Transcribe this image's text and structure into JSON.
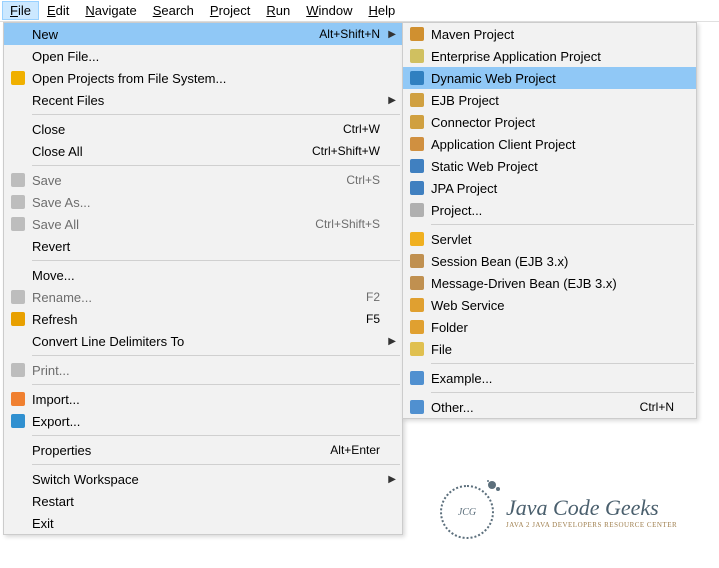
{
  "menubar": [
    {
      "label": "File",
      "mn": "F",
      "active": true
    },
    {
      "label": "Edit",
      "mn": "E"
    },
    {
      "label": "Navigate",
      "mn": "N"
    },
    {
      "label": "Search",
      "mn": "S"
    },
    {
      "label": "Project",
      "mn": "P"
    },
    {
      "label": "Run",
      "mn": "R"
    },
    {
      "label": "Window",
      "mn": "W"
    },
    {
      "label": "Help",
      "mn": "H"
    }
  ],
  "file_menu": [
    {
      "label": "New",
      "accel": "Alt+Shift+N",
      "submenu": true,
      "highlighted": true
    },
    {
      "label": "Open File..."
    },
    {
      "label": "Open Projects from File System...",
      "icon": "folder-open-icon",
      "iconColor": "#f0b000"
    },
    {
      "label": "Recent Files",
      "submenu": true
    },
    {
      "sep": true
    },
    {
      "label": "Close",
      "accel": "Ctrl+W"
    },
    {
      "label": "Close All",
      "accel": "Ctrl+Shift+W"
    },
    {
      "sep": true
    },
    {
      "label": "Save",
      "accel": "Ctrl+S",
      "disabled": true,
      "icon": "save-icon",
      "iconColor": "#bdbdbd"
    },
    {
      "label": "Save As...",
      "disabled": true,
      "icon": "save-as-icon",
      "iconColor": "#bdbdbd"
    },
    {
      "label": "Save All",
      "accel": "Ctrl+Shift+S",
      "disabled": true,
      "icon": "save-all-icon",
      "iconColor": "#bdbdbd"
    },
    {
      "label": "Revert"
    },
    {
      "sep": true
    },
    {
      "label": "Move..."
    },
    {
      "label": "Rename...",
      "accel": "F2",
      "disabled": true,
      "icon": "rename-icon",
      "iconColor": "#bdbdbd"
    },
    {
      "label": "Refresh",
      "accel": "F5",
      "icon": "refresh-icon",
      "iconColor": "#e8a000"
    },
    {
      "label": "Convert Line Delimiters To",
      "submenu": true
    },
    {
      "sep": true
    },
    {
      "label": "Print...",
      "disabled": true,
      "icon": "print-icon",
      "iconColor": "#bdbdbd"
    },
    {
      "sep": true
    },
    {
      "label": "Import...",
      "icon": "import-icon",
      "iconColor": "#f08030"
    },
    {
      "label": "Export...",
      "icon": "export-icon",
      "iconColor": "#3090d0"
    },
    {
      "sep": true
    },
    {
      "label": "Properties",
      "accel": "Alt+Enter"
    },
    {
      "sep": true
    },
    {
      "label": "Switch Workspace",
      "submenu": true
    },
    {
      "label": "Restart"
    },
    {
      "label": "Exit"
    }
  ],
  "new_submenu": [
    {
      "label": "Maven Project",
      "icon": "maven-project-icon",
      "iconColor": "#d09030"
    },
    {
      "label": "Enterprise Application Project",
      "icon": "ear-project-icon",
      "iconColor": "#d0c060"
    },
    {
      "label": "Dynamic Web Project",
      "highlighted": true,
      "icon": "dynamic-web-project-icon",
      "iconColor": "#3080c0"
    },
    {
      "label": "EJB Project",
      "icon": "ejb-project-icon",
      "iconColor": "#d0a040"
    },
    {
      "label": "Connector Project",
      "icon": "connector-project-icon",
      "iconColor": "#d0a040"
    },
    {
      "label": "Application Client Project",
      "icon": "app-client-project-icon",
      "iconColor": "#d09040"
    },
    {
      "label": "Static Web Project",
      "icon": "static-web-project-icon",
      "iconColor": "#4080c0"
    },
    {
      "label": "JPA Project",
      "icon": "jpa-project-icon",
      "iconColor": "#4080c0"
    },
    {
      "label": "Project...",
      "icon": "project-icon",
      "iconColor": "#b0b0b0"
    },
    {
      "sep": true
    },
    {
      "label": "Servlet",
      "icon": "servlet-icon",
      "iconColor": "#f0b020"
    },
    {
      "label": "Session Bean (EJB 3.x)",
      "icon": "session-bean-icon",
      "iconColor": "#c09050"
    },
    {
      "label": "Message-Driven Bean (EJB 3.x)",
      "icon": "mdb-icon",
      "iconColor": "#c09050"
    },
    {
      "label": "Web Service",
      "icon": "web-service-icon",
      "iconColor": "#e0a030"
    },
    {
      "label": "Folder",
      "icon": "folder-icon",
      "iconColor": "#e0a030"
    },
    {
      "label": "File",
      "icon": "file-icon",
      "iconColor": "#e0c050"
    },
    {
      "sep": true
    },
    {
      "label": "Example...",
      "icon": "example-icon",
      "iconColor": "#5090d0"
    },
    {
      "sep": true
    },
    {
      "label": "Other...",
      "accel": "Ctrl+N",
      "icon": "other-icon",
      "iconColor": "#5090d0"
    }
  ],
  "watermark": {
    "logo_text": "JCG",
    "title": "Java Code Geeks",
    "subtitle": "Java 2 Java Developers Resource Center"
  }
}
